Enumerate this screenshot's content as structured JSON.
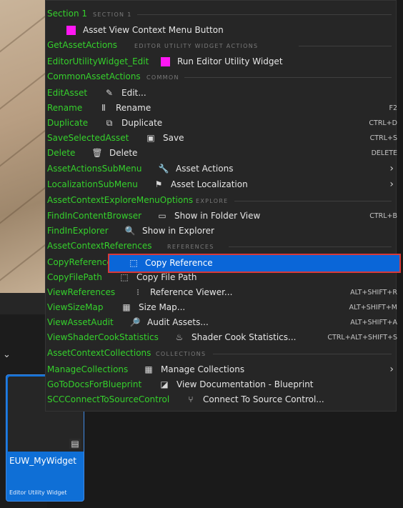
{
  "colors": {
    "menu_background": "#262626",
    "section_name": "#35d12c",
    "section_header": "#7a7a7a",
    "highlight": "#0a66d8",
    "highlight_border": "#d83a3a",
    "asset_tile": "#0f6fd6",
    "magenta_marker": "#ff17f3"
  },
  "asset": {
    "name": "EUW_MyWidget",
    "type": "Editor Utility Widget"
  },
  "menu": {
    "section1": {
      "name": "Section 1",
      "header": "SECTION 1"
    },
    "asset_view_button": {
      "label": "Asset View Context Menu Button"
    },
    "get_asset_actions": {
      "name": "GetAssetActions",
      "header": "EDITOR UTILITY WIDGET ACTIONS"
    },
    "run_editor_utility": {
      "name": "EditorUtilityWidget_Edit",
      "label": "Run Editor Utility Widget"
    },
    "common_section": {
      "name": "CommonAssetActions",
      "header": "COMMON"
    },
    "edit": {
      "name": "EditAsset",
      "label": "Edit...",
      "icon": "pencil-icon"
    },
    "rename": {
      "name": "Rename",
      "label": "Rename",
      "shortcut": "F2",
      "icon": "rename-icon"
    },
    "duplicate": {
      "name": "Duplicate",
      "label": "Duplicate",
      "shortcut": "CTRL+D",
      "icon": "duplicate-icon"
    },
    "save": {
      "name": "SaveSelectedAsset",
      "label": "Save",
      "shortcut": "CTRL+S",
      "icon": "save-icon"
    },
    "delete": {
      "name": "Delete",
      "label": "Delete",
      "shortcut": "DELETE",
      "icon": "trash-icon"
    },
    "asset_actions": {
      "name": "AssetActionsSubMenu",
      "label": "Asset Actions",
      "icon": "wrench-icon"
    },
    "asset_localization": {
      "name": "LocalizationSubMenu",
      "label": "Asset Localization",
      "icon": "flag-icon"
    },
    "explore_section": {
      "name": "AssetContextExploreMenuOptions",
      "header": "EXPLORE"
    },
    "show_folder": {
      "name": "FindInContentBrowser",
      "label": "Show in Folder View",
      "shortcut": "CTRL+B",
      "icon": "folder-icon"
    },
    "show_explorer": {
      "name": "FindInExplorer",
      "label": "Show in Explorer",
      "icon": "folder-search-icon"
    },
    "references_section": {
      "name": "AssetContextReferences",
      "header": "REFERENCES"
    },
    "copy_reference": {
      "name": "CopyReference",
      "label": "Copy Reference",
      "icon": "copy-reference-icon"
    },
    "copy_file_path": {
      "name": "CopyFilePath",
      "label": "Copy File Path",
      "icon": "copy-path-icon"
    },
    "reference_viewer": {
      "name": "ViewReferences",
      "label": "Reference Viewer...",
      "shortcut": "ALT+SHIFT+R",
      "icon": "reference-viewer-icon"
    },
    "size_map": {
      "name": "ViewSizeMap",
      "label": "Size Map...",
      "shortcut": "ALT+SHIFT+M",
      "icon": "size-map-icon"
    },
    "audit_assets": {
      "name": "ViewAssetAudit",
      "label": "Audit Assets...",
      "shortcut": "ALT+SHIFT+A",
      "icon": "audit-icon"
    },
    "shader_cook": {
      "name": "ViewShaderCookStatistics",
      "label": "Shader Cook Statistics...",
      "shortcut": "CTRL+ALT+SHIFT+S",
      "icon": "shader-icon"
    },
    "collections_section": {
      "name": "AssetContextCollections",
      "header": "COLLECTIONS"
    },
    "manage_collections": {
      "name": "ManageCollections",
      "label": "Manage Collections",
      "icon": "collections-icon"
    },
    "view_docs": {
      "name": "GoToDocsForBlueprint",
      "label": "View Documentation - Blueprint",
      "icon": "book-icon"
    },
    "source_control": {
      "name": "SCCConnectToSourceControl",
      "label": "Connect To Source Control...",
      "icon": "source-control-icon"
    }
  }
}
